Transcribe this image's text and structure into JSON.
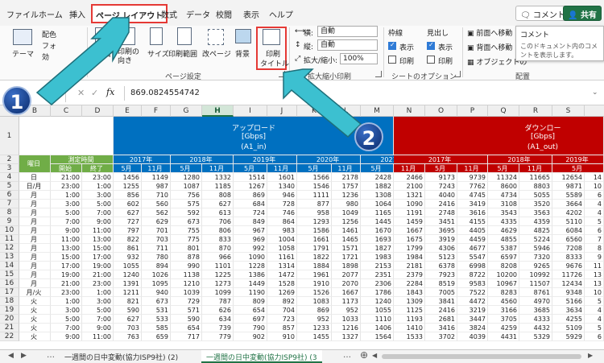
{
  "tabs": [
    "ファイル",
    "ホーム",
    "挿入",
    "ページ レイアウト",
    "数式",
    "データ",
    "校閲",
    "表示",
    "ヘルプ"
  ],
  "active_tab_index": 3,
  "top_buttons": {
    "comment": "コメント",
    "share": "共有"
  },
  "ribbon": {
    "theme": {
      "theme": "テーマ",
      "colors": "配色",
      "fonts": "フォ",
      "effects": "効"
    },
    "page_setup": {
      "margins": "余白",
      "orientation": "印刷の向き",
      "size": "サイズ",
      "print_area": "印刷範囲",
      "breaks": "改ページ",
      "background": "背景",
      "print_titles": "印刷タイトル",
      "group": "ページ設定"
    },
    "scale": {
      "width_label": "横:",
      "width_value": "自動",
      "height_label": "縦:",
      "height_value": "自動",
      "scale_label": "拡大/縮小:",
      "scale_value": "100%",
      "group": "拡大縮小印刷"
    },
    "sheet_options": {
      "gridlines": "枠線",
      "headings": "見出し",
      "view": "表示",
      "print": "印刷",
      "group": "シートのオプション"
    },
    "arrange": {
      "bring_forward": "前面へ移動",
      "send_backward": "背面へ移動",
      "selection_pane": "オブジェクトの",
      "group": "配置"
    }
  },
  "tooltip": {
    "title": "コメント",
    "body": "このドキュメント内のコメントを表示します。"
  },
  "formula_bar": {
    "fx": "fx",
    "value": "869.0824554742"
  },
  "columns": [
    "B",
    "C",
    "D",
    "E",
    "F",
    "G",
    "H",
    "I",
    "J",
    "K",
    "L",
    "M",
    "N",
    "O",
    "P",
    "Q",
    "R",
    "S"
  ],
  "selected_column": "H",
  "headers": {
    "upload": "アップロード",
    "upload_unit": "[Gbps]",
    "upload_id": "(A1_in)",
    "download": "ダウンロー",
    "download_unit": "[Gbps]",
    "download_id": "(A1_out)",
    "day": "曜日",
    "time": "測定時間",
    "start": "開始",
    "end": "終了",
    "years_up": [
      "2017年",
      "2018年",
      "2019年",
      "2020年",
      "2021年"
    ],
    "years_down": [
      "2017年",
      "2018年",
      "2019年"
    ],
    "month_may": "5月",
    "month_nov": "11月"
  },
  "rows": [
    {
      "n": "4",
      "day": "日",
      "s": "21:00",
      "e": "23:00",
      "v": [
        "1456",
        "1149",
        "1280",
        "1332",
        "1514",
        "1601",
        "1566",
        "2178",
        "2428",
        "2466",
        "9173",
        "9739",
        "11324",
        "11665",
        "12654",
        "14"
      ]
    },
    {
      "n": "5",
      "day": "日/月",
      "s": "23:00",
      "e": "1:00",
      "v": [
        "1255",
        "987",
        "1087",
        "1185",
        "1267",
        "1340",
        "1546",
        "1757",
        "1882",
        "2100",
        "7243",
        "7762",
        "8600",
        "8803",
        "9871",
        "10"
      ]
    },
    {
      "n": "6",
      "day": "月",
      "s": "1:00",
      "e": "3:00",
      "v": [
        "856",
        "710",
        "756",
        "808",
        "869",
        "946",
        "1111",
        "1236",
        "1308",
        "1321",
        "4040",
        "4745",
        "4734",
        "5055",
        "5589",
        "6"
      ]
    },
    {
      "n": "7",
      "day": "月",
      "s": "3:00",
      "e": "5:00",
      "v": [
        "602",
        "560",
        "575",
        "627",
        "684",
        "728",
        "877",
        "980",
        "1064",
        "1090",
        "2416",
        "3419",
        "3108",
        "3520",
        "3664",
        "4"
      ]
    },
    {
      "n": "8",
      "day": "月",
      "s": "5:00",
      "e": "7:00",
      "v": [
        "627",
        "562",
        "592",
        "613",
        "724",
        "746",
        "958",
        "1049",
        "1165",
        "1191",
        "2748",
        "3616",
        "3543",
        "3563",
        "4202",
        "4"
      ]
    },
    {
      "n": "9",
      "day": "月",
      "s": "7:00",
      "e": "9:00",
      "v": [
        "727",
        "629",
        "673",
        "706",
        "849",
        "864",
        "1293",
        "1256",
        "1445",
        "1459",
        "3451",
        "4155",
        "4335",
        "4359",
        "5110",
        "5"
      ]
    },
    {
      "n": "10",
      "day": "月",
      "s": "9:00",
      "e": "11:00",
      "v": [
        "797",
        "701",
        "755",
        "806",
        "967",
        "983",
        "1586",
        "1461",
        "1670",
        "1667",
        "3695",
        "4405",
        "4629",
        "4825",
        "6084",
        "6"
      ]
    },
    {
      "n": "11",
      "day": "月",
      "s": "11:00",
      "e": "13:00",
      "v": [
        "822",
        "703",
        "775",
        "833",
        "969",
        "1004",
        "1661",
        "1465",
        "1693",
        "1675",
        "3919",
        "4459",
        "4855",
        "5224",
        "6560",
        "7"
      ]
    },
    {
      "n": "12",
      "day": "月",
      "s": "13:00",
      "e": "15:00",
      "v": [
        "861",
        "711",
        "801",
        "870",
        "992",
        "1058",
        "1791",
        "1571",
        "1827",
        "1799",
        "4306",
        "4677",
        "5387",
        "5946",
        "7208",
        "8"
      ]
    },
    {
      "n": "13",
      "day": "月",
      "s": "15:00",
      "e": "17:00",
      "v": [
        "932",
        "780",
        "878",
        "966",
        "1090",
        "1161",
        "1822",
        "1721",
        "1983",
        "1984",
        "5123",
        "5547",
        "6597",
        "7320",
        "8333",
        "9"
      ]
    },
    {
      "n": "14",
      "day": "月",
      "s": "17:00",
      "e": "19:00",
      "v": [
        "1055",
        "894",
        "990",
        "1101",
        "1228",
        "1314",
        "1884",
        "1898",
        "2153",
        "2181",
        "6378",
        "6998",
        "8208",
        "9265",
        "9676",
        "11"
      ]
    },
    {
      "n": "15",
      "day": "月",
      "s": "19:00",
      "e": "21:00",
      "v": [
        "1240",
        "1026",
        "1138",
        "1225",
        "1386",
        "1472",
        "1961",
        "2077",
        "2351",
        "2379",
        "7923",
        "8722",
        "10200",
        "10992",
        "11726",
        "13"
      ]
    },
    {
      "n": "16",
      "day": "月",
      "s": "21:00",
      "e": "23:00",
      "v": [
        "1391",
        "1095",
        "1210",
        "1273",
        "1449",
        "1528",
        "1910",
        "2070",
        "2306",
        "2284",
        "8519",
        "9583",
        "10967",
        "11507",
        "12434",
        "13"
      ]
    },
    {
      "n": "17",
      "day": "月/火",
      "s": "23:00",
      "e": "1:00",
      "v": [
        "1211",
        "940",
        "1039",
        "1099",
        "1190",
        "1269",
        "1526",
        "1667",
        "1786",
        "1843",
        "7005",
        "7522",
        "8283",
        "8761",
        "9348",
        "10"
      ]
    },
    {
      "n": "18",
      "day": "火",
      "s": "1:00",
      "e": "3:00",
      "v": [
        "821",
        "673",
        "729",
        "787",
        "809",
        "892",
        "1083",
        "1173",
        "1240",
        "1309",
        "3841",
        "4472",
        "4560",
        "4970",
        "5166",
        "5"
      ]
    },
    {
      "n": "19",
      "day": "火",
      "s": "3:00",
      "e": "5:00",
      "v": [
        "590",
        "531",
        "571",
        "626",
        "654",
        "704",
        "869",
        "952",
        "1055",
        "1125",
        "2416",
        "3219",
        "3166",
        "3685",
        "3634",
        "4"
      ]
    },
    {
      "n": "20",
      "day": "火",
      "s": "5:00",
      "e": "7:00",
      "v": [
        "627",
        "533",
        "590",
        "634",
        "697",
        "723",
        "952",
        "1033",
        "1110",
        "1193",
        "2681",
        "3447",
        "3705",
        "4333",
        "4255",
        "4"
      ]
    },
    {
      "n": "21",
      "day": "火",
      "s": "7:00",
      "e": "9:00",
      "v": [
        "703",
        "585",
        "654",
        "739",
        "790",
        "857",
        "1233",
        "1216",
        "1406",
        "1410",
        "3416",
        "3824",
        "4259",
        "4432",
        "5109",
        "5"
      ]
    },
    {
      "n": "22",
      "day": "火",
      "s": "9:00",
      "e": "11:00",
      "v": [
        "763",
        "659",
        "717",
        "779",
        "902",
        "910",
        "1455",
        "1327",
        "1564",
        "1533",
        "3702",
        "4039",
        "4431",
        "5329",
        "5929",
        "6"
      ]
    }
  ],
  "sheets": [
    "一週間の日中変動(協力ISP9社) (2)",
    "一週間の日中変動(協力ISP9社) (3"
  ],
  "active_sheet_index": 1,
  "badges": [
    "1",
    "2"
  ]
}
